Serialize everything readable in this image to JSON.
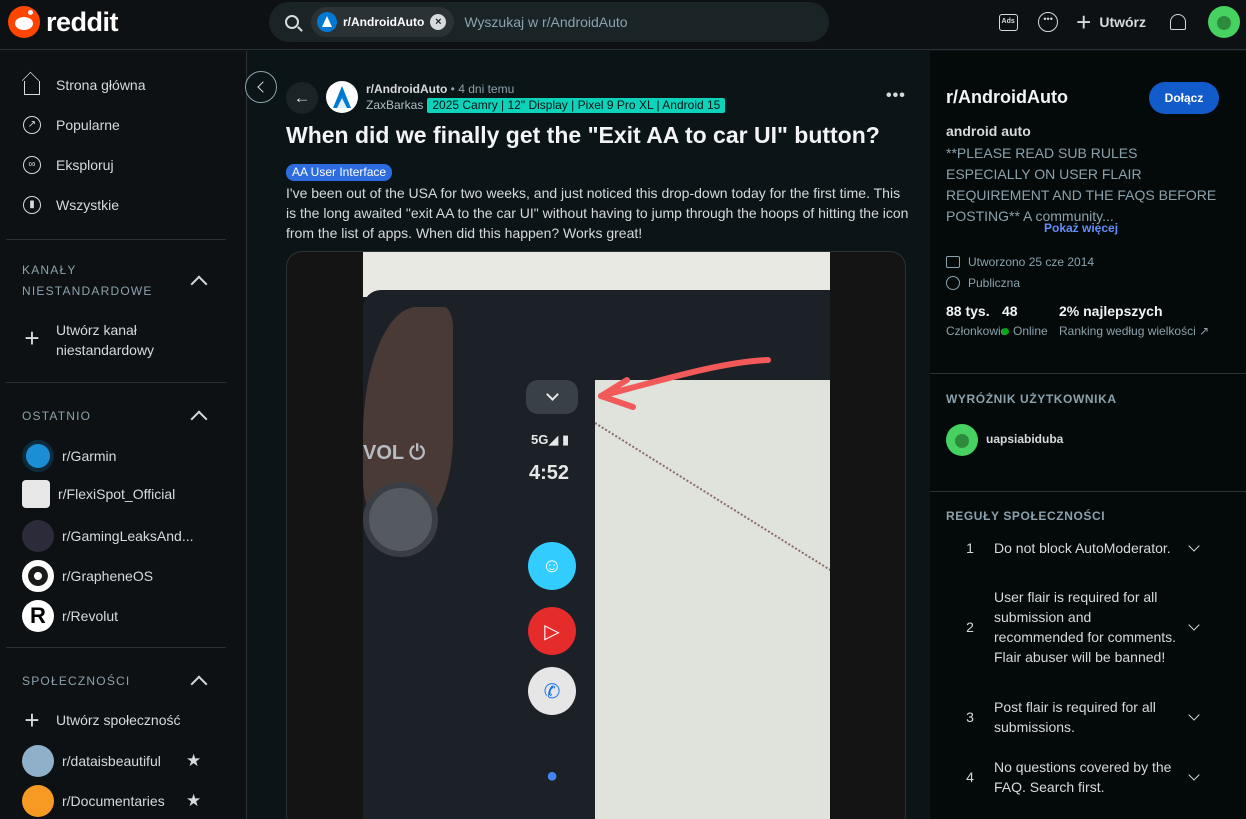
{
  "header": {
    "logo_text": "reddit",
    "search_chip": "r/AndroidAuto",
    "search_placeholder": "Wyszukaj w r/AndroidAuto",
    "ads_label": "Ads",
    "create_label": "Utwórz"
  },
  "sidebar": {
    "nav": [
      {
        "label": "Strona główna",
        "icon": "home-icon"
      },
      {
        "label": "Popularne",
        "icon": "popular-icon"
      },
      {
        "label": "Eksploruj",
        "icon": "explore-icon"
      },
      {
        "label": "Wszystkie",
        "icon": "all-icon"
      }
    ],
    "custom_feeds_title": "KANAŁY NIESTANDARDOWE",
    "create_custom_feed": "Utwórz kanał niestandardowy",
    "recent_title": "OSTATNIO",
    "recent": [
      {
        "name": "r/Garmin",
        "color": "#1b8ed6"
      },
      {
        "name": "r/FlexiSpot_Official",
        "color": "#e8e8e8"
      },
      {
        "name": "r/GamingLeaksAnd...",
        "color": "#2b2b3a"
      },
      {
        "name": "r/GrapheneOS",
        "color": "#ffffff"
      },
      {
        "name": "r/Revolut",
        "color": "#ffffff"
      }
    ],
    "communities_title": "SPOŁECZNOŚCI",
    "create_community": "Utwórz społeczność",
    "communities": [
      {
        "name": "r/dataisbeautiful",
        "color": "#8fb0c8"
      },
      {
        "name": "r/Documentaries",
        "color": "#f79a24"
      }
    ]
  },
  "post": {
    "subreddit": "r/AndroidAuto",
    "time": "• 4 dni temu",
    "author": "ZaxBarkas",
    "user_flair": "2025 Camry | 12\" Display | Pixel 9 Pro XL | Android 15",
    "title": "When did we finally get the \"Exit AA to car UI\" button?",
    "flair": "AA User Interface",
    "body": "I've been out of the USA for two weeks, and just noticed this drop-down today for the first time. This is the long awaited \"exit AA to the car UI\" without having to jump through the hoops of hitting the icon from the list of apps. When did this happen? Works great!",
    "more_label": "•••",
    "image": {
      "vol_label": "VOL ⏻",
      "signal": "5G◢ ▮",
      "clock": "4:52"
    }
  },
  "community": {
    "title": "r/AndroidAuto",
    "join_label": "Dołącz",
    "name": "android auto",
    "description": "**PLEASE READ SUB RULES ESPECIALLY ON USER FLAIR REQUIREMENT AND THE FAQS BEFORE POSTING** A community...",
    "show_more": "Pokaż więcej",
    "created": "Utworzono 25 cze 2014",
    "visibility": "Publiczna",
    "members_count": "88 tys.",
    "members_label": "Członkowie",
    "online_count": "48",
    "online_label": "Online",
    "rank": "2% najlepszych",
    "rank_label": "Ranking według wielkości",
    "user_flair_title": "WYRÓŻNIK UŻYTKOWNIKA",
    "username": "uapsiabiduba",
    "rules_title": "REGUŁY SPOŁECZNOŚCI",
    "rules": [
      {
        "num": "1",
        "text": "Do not block AutoModerator."
      },
      {
        "num": "2",
        "text": "User flair is required for all submission and recommended for comments. Flair abuser will be banned!"
      },
      {
        "num": "3",
        "text": "Post flair is required for all submissions."
      },
      {
        "num": "4",
        "text": "No questions covered by the FAQ. Search first."
      }
    ]
  }
}
